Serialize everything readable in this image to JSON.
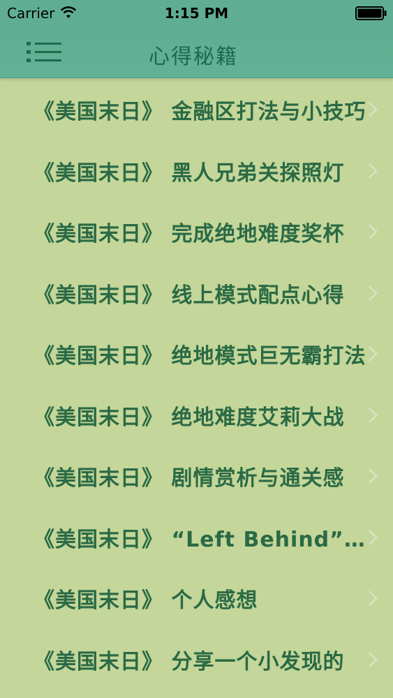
{
  "status_bar": {
    "carrier": "Carrier",
    "time": "1:15 PM",
    "wifi_icon": "wifi-icon",
    "battery_icon": "battery-icon"
  },
  "nav_bar": {
    "title": "心得秘籍",
    "menu_icon": "menu-icon"
  },
  "colors": {
    "nav_background": "#5fae94",
    "list_background": "#c4d699",
    "text": "#2a6a45"
  },
  "list": {
    "items": [
      {
        "label": "《美国末日》 金融区打法与小技巧"
      },
      {
        "label": "《美国末日》 黑人兄弟关探照灯"
      },
      {
        "label": "《美国末日》 完成绝地难度奖杯"
      },
      {
        "label": "《美国末日》 线上模式配点心得"
      },
      {
        "label": "《美国末日》 绝地模式巨无霸打法"
      },
      {
        "label": "《美国末日》 绝地难度艾莉大战"
      },
      {
        "label": "《美国末日》 剧情赏析与通关感"
      },
      {
        "label": "《美国末日》 “Left Behind”DLC"
      },
      {
        "label": "《美国末日》 个人感想"
      },
      {
        "label": "《美国末日》 分享一个小发现的"
      }
    ]
  }
}
